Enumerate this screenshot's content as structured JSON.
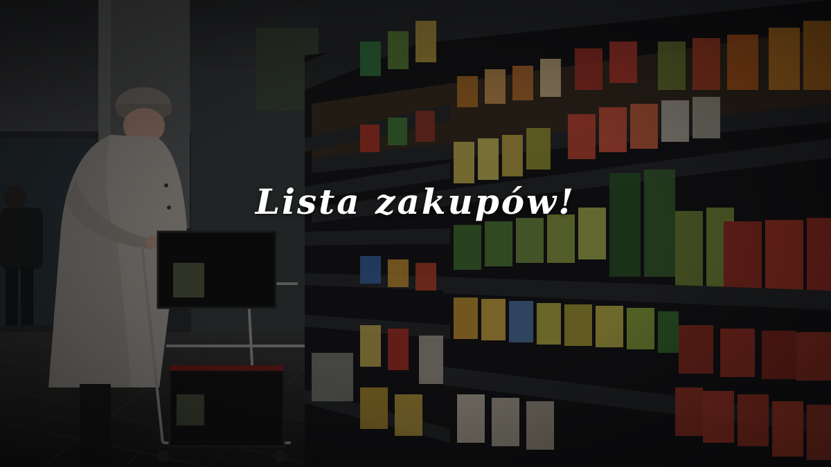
{
  "title": "Lista zakupów!",
  "colors": {
    "overlay": "#000000",
    "title_text": "#ffffff",
    "shelf_edge": "#2a2c2f"
  },
  "scene": {
    "content": "photo-background-supermarket"
  }
}
